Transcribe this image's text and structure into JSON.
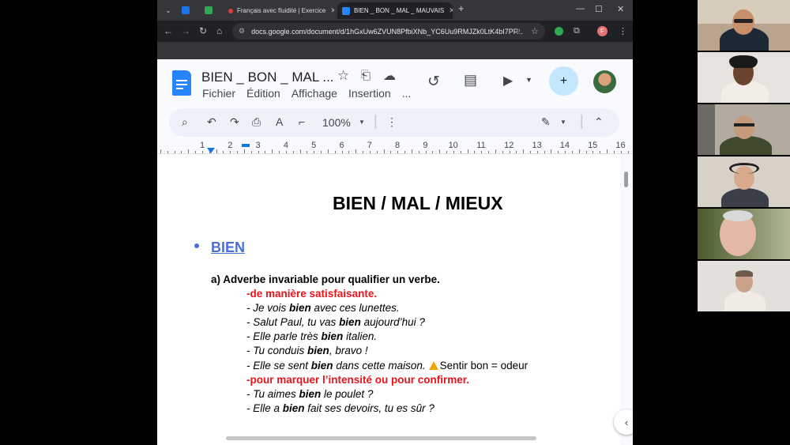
{
  "browser": {
    "tabs": [
      {
        "title": "Français avec fluidité | Exercice",
        "active": false
      },
      {
        "title": "BIEN _ BON _ MAL _ MAUVAIS",
        "active": true
      }
    ],
    "new_tab_symbol": "+",
    "url": "docs.google.com/document/d/1hGxUw6ZVUN8PfbiXNb_YC6Uu9RMJZk0LtK4bI7PF...",
    "profile_initial": "F"
  },
  "docs": {
    "title": "BIEN _ BON _ MAL ...",
    "menus": [
      "Fichier",
      "Édition",
      "Affichage",
      "Insertion",
      "..."
    ],
    "zoom": "100%",
    "ruler_numbers": [
      "1",
      "2",
      "3",
      "4",
      "5",
      "6",
      "7",
      "8",
      "9",
      "10",
      "11",
      "12",
      "13",
      "14",
      "15",
      "16"
    ]
  },
  "document": {
    "heading": "BIEN / MAL / MIEUX",
    "section": "BIEN",
    "subsection": "a)  Adverbe invariable pour qualifier un verbe.",
    "lines": [
      {
        "kind": "red",
        "text": "-de manière satisfaisante."
      },
      {
        "kind": "ex",
        "pre": "- Je vois ",
        "bold": "bien",
        "post": " avec ces lunettes."
      },
      {
        "kind": "ex",
        "pre": "- Salut Paul, tu vas ",
        "bold": "bien",
        "post": " aujourd’hui ?"
      },
      {
        "kind": "ex",
        "pre": "- Elle parle très ",
        "bold": "bien",
        "post": " italien."
      },
      {
        "kind": "ex",
        "pre": "- Tu conduis ",
        "bold": "bien",
        "post": ", bravo !"
      },
      {
        "kind": "ex",
        "pre": "- Elle se sent ",
        "bold": "bien",
        "post": " dans cette maison.",
        "note": "Sentir bon = odeur"
      },
      {
        "kind": "red",
        "text": "-pour marquer l’intensité ou pour confirmer."
      },
      {
        "kind": "ex",
        "pre": "- Tu aimes ",
        "bold": "bien",
        "post": " le poulet ?"
      },
      {
        "kind": "ex",
        "pre": "- Elle a ",
        "bold": "bien",
        "post": " fait ses devoirs, tu es sûr ?"
      }
    ]
  },
  "colors": {
    "accent_red": "#e8141c",
    "link_blue": "#4a6fdc",
    "docs_blue": "#2684fc",
    "share_bg": "#c2e7ff"
  },
  "participants": [
    {
      "icon": "participant-video-1"
    },
    {
      "icon": "participant-video-2"
    },
    {
      "icon": "participant-video-3"
    },
    {
      "icon": "participant-video-4"
    },
    {
      "icon": "participant-video-5"
    },
    {
      "icon": "participant-video-6"
    }
  ]
}
